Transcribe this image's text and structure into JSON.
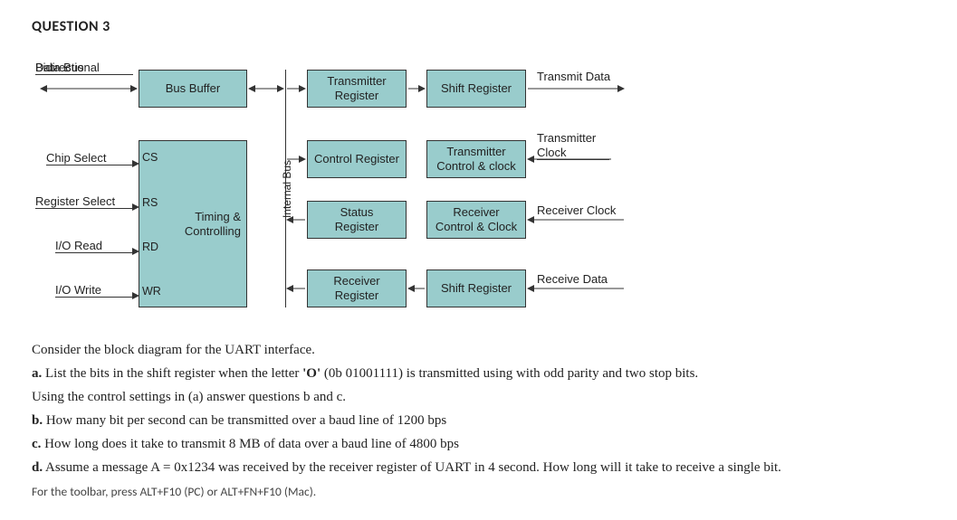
{
  "title": "QUESTION 3",
  "diagram": {
    "labels": {
      "bidir1": "Bidirectional",
      "bidir2": "Data Bus",
      "chip_select": "Chip Select",
      "register_select": "Register Select",
      "io_read": "I/O Read",
      "io_write": "I/O Write",
      "cs": "CS",
      "rs": "RS",
      "rd": "RD",
      "wr": "WR",
      "transmit_data": "Transmit Data",
      "transmitter_clock1": "Transmitter",
      "transmitter_clock2": "Clock",
      "receiver_clock": "Receiver Clock",
      "receive_data": "Receive Data",
      "internal_bus": "Internal Bus"
    },
    "boxes": {
      "bus_buffer": "Bus Buffer",
      "timing1": "Timing &",
      "timing2": "Controlling",
      "transmitter_register1": "Transmitter",
      "transmitter_register2": "Register",
      "control_register": "Control Register",
      "status_register1": "Status",
      "status_register2": "Register",
      "receiver_register1": "Receiver",
      "receiver_register2": "Register",
      "shift_register_top": "Shift Register",
      "transmitter_cc1": "Transmitter",
      "transmitter_cc2": "Control & clock",
      "receiver_cc1": "Receiver",
      "receiver_cc2": "Control & Clock",
      "shift_register_bot": "Shift Register"
    }
  },
  "text": {
    "intro": "Consider the block diagram for the UART interface.",
    "a_prefix": "a.",
    "a_text": " List the bits in the shift register when the letter ",
    "a_letter": "'O'",
    "a_tail": " (0b 01001111) is transmitted using with odd parity and two stop bits.",
    "using": "Using the control settings in (a)  answer questions b and c.",
    "b_prefix": "b.",
    "b_text": " How many bit per second can be transmitted over a baud line  of 1200 bps",
    "c_prefix": "c.",
    "c_text": " How long does it take to transmit 8 MB of data over a baud line  of 4800 bps",
    "d_prefix": "d.",
    "d_text": " Assume a message A = 0x1234 was received by the receiver register of UART  in 4 second. How long will it take to receive a single bit.",
    "toolbar": "For the toolbar, press ALT+F10 (PC) or ALT+FN+F10 (Mac)."
  }
}
